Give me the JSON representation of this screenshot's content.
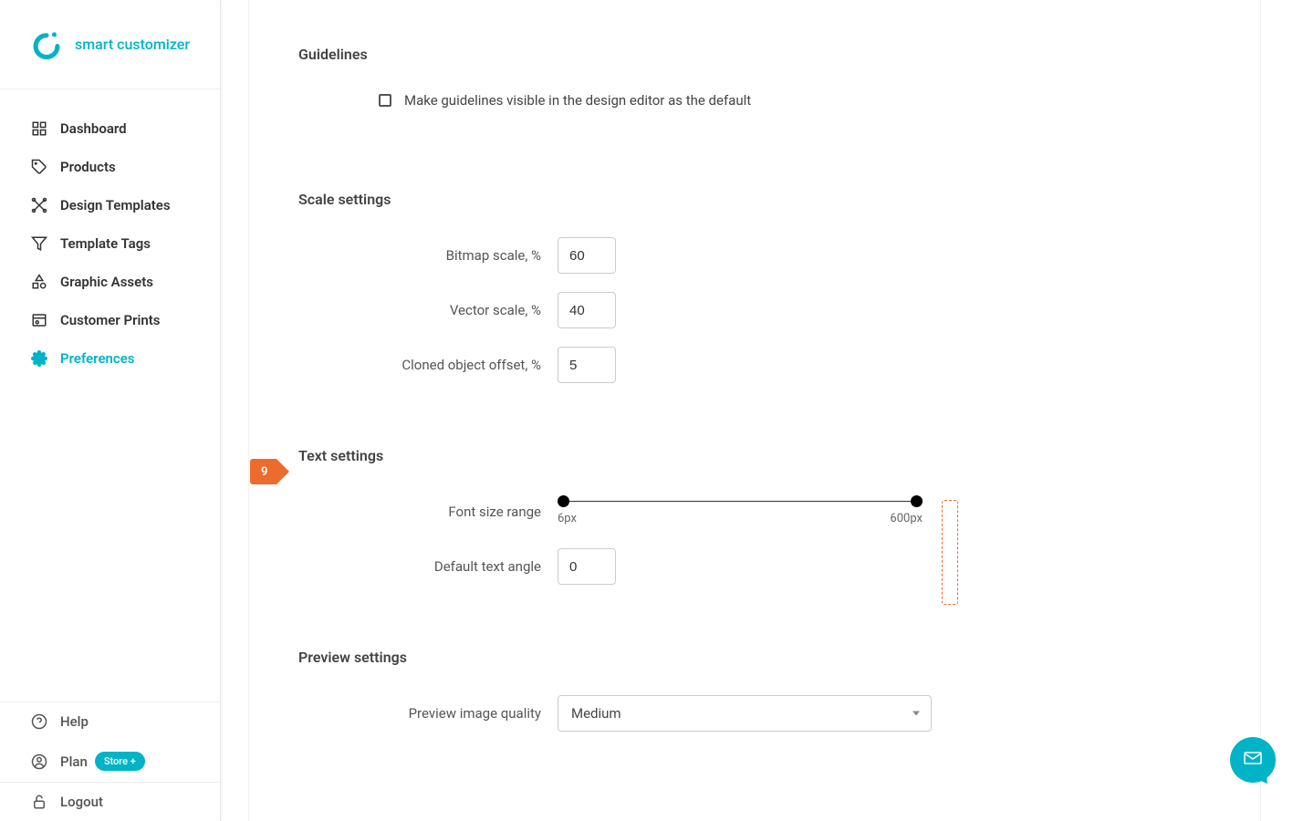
{
  "app": {
    "name": "smart customizer"
  },
  "sidebar": {
    "items": [
      {
        "label": "Dashboard"
      },
      {
        "label": "Products"
      },
      {
        "label": "Design Templates"
      },
      {
        "label": "Template Tags"
      },
      {
        "label": "Graphic Assets"
      },
      {
        "label": "Customer Prints"
      },
      {
        "label": "Preferences"
      }
    ],
    "bottom": {
      "help": "Help",
      "plan": "Plan",
      "plan_badge": "Store +",
      "logout": "Logout"
    }
  },
  "sections": {
    "guidelines": {
      "title": "Guidelines",
      "checkbox_label": "Make guidelines visible in the design editor as the default"
    },
    "scale": {
      "title": "Scale settings",
      "bitmap_label": "Bitmap scale, %",
      "bitmap_value": "60",
      "vector_label": "Vector scale, %",
      "vector_value": "40",
      "cloned_label": "Cloned object offset, %",
      "cloned_value": "5"
    },
    "text": {
      "title": "Text settings",
      "step_number": "9",
      "font_range_label": "Font size range",
      "font_min": "6px",
      "font_max": "600px",
      "angle_label": "Default text angle",
      "angle_value": "0"
    },
    "preview": {
      "title": "Preview settings",
      "quality_label": "Preview image quality",
      "quality_value": "Medium"
    }
  }
}
